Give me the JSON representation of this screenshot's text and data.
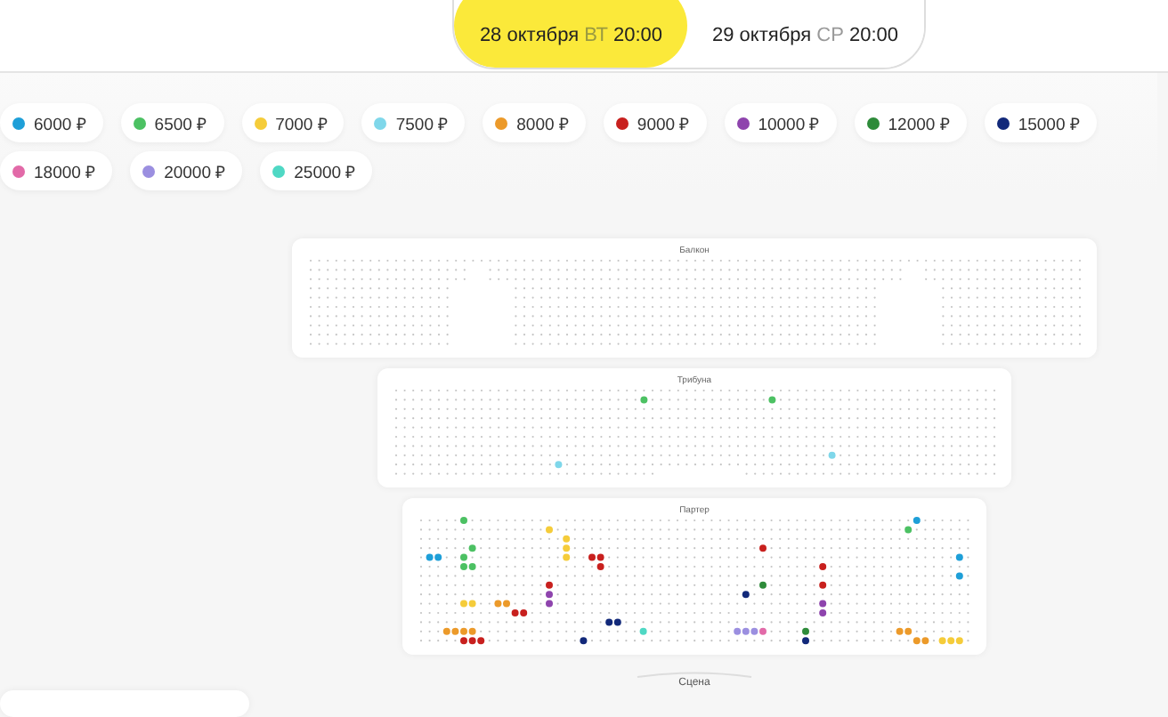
{
  "dates": [
    {
      "date": "28 октября",
      "weekday": "ВТ",
      "time": "20:00",
      "selected": true
    },
    {
      "date": "29 октября",
      "weekday": "СР",
      "time": "20:00",
      "selected": false
    }
  ],
  "prices": [
    {
      "label": "6000 ₽",
      "color": "#1e9fd8"
    },
    {
      "label": "6500 ₽",
      "color": "#4cc163"
    },
    {
      "label": "7000 ₽",
      "color": "#f5cc3a"
    },
    {
      "label": "7500 ₽",
      "color": "#7fd7ea"
    },
    {
      "label": "8000 ₽",
      "color": "#ec9a2a"
    },
    {
      "label": "9000 ₽",
      "color": "#c8201e"
    },
    {
      "label": "10000 ₽",
      "color": "#8e44ad"
    },
    {
      "label": "12000 ₽",
      "color": "#2e8b3a"
    },
    {
      "label": "15000 ₽",
      "color": "#12297a"
    },
    {
      "label": "18000 ₽",
      "color": "#e26aa8"
    },
    {
      "label": "20000 ₽",
      "color": "#9b8fe0"
    },
    {
      "label": "25000 ₽",
      "color": "#4fd8c4"
    }
  ],
  "sections": [
    {
      "title": "Балкон"
    },
    {
      "title": "Трибуна"
    },
    {
      "title": "Партер"
    }
  ],
  "stage": "Сцена"
}
